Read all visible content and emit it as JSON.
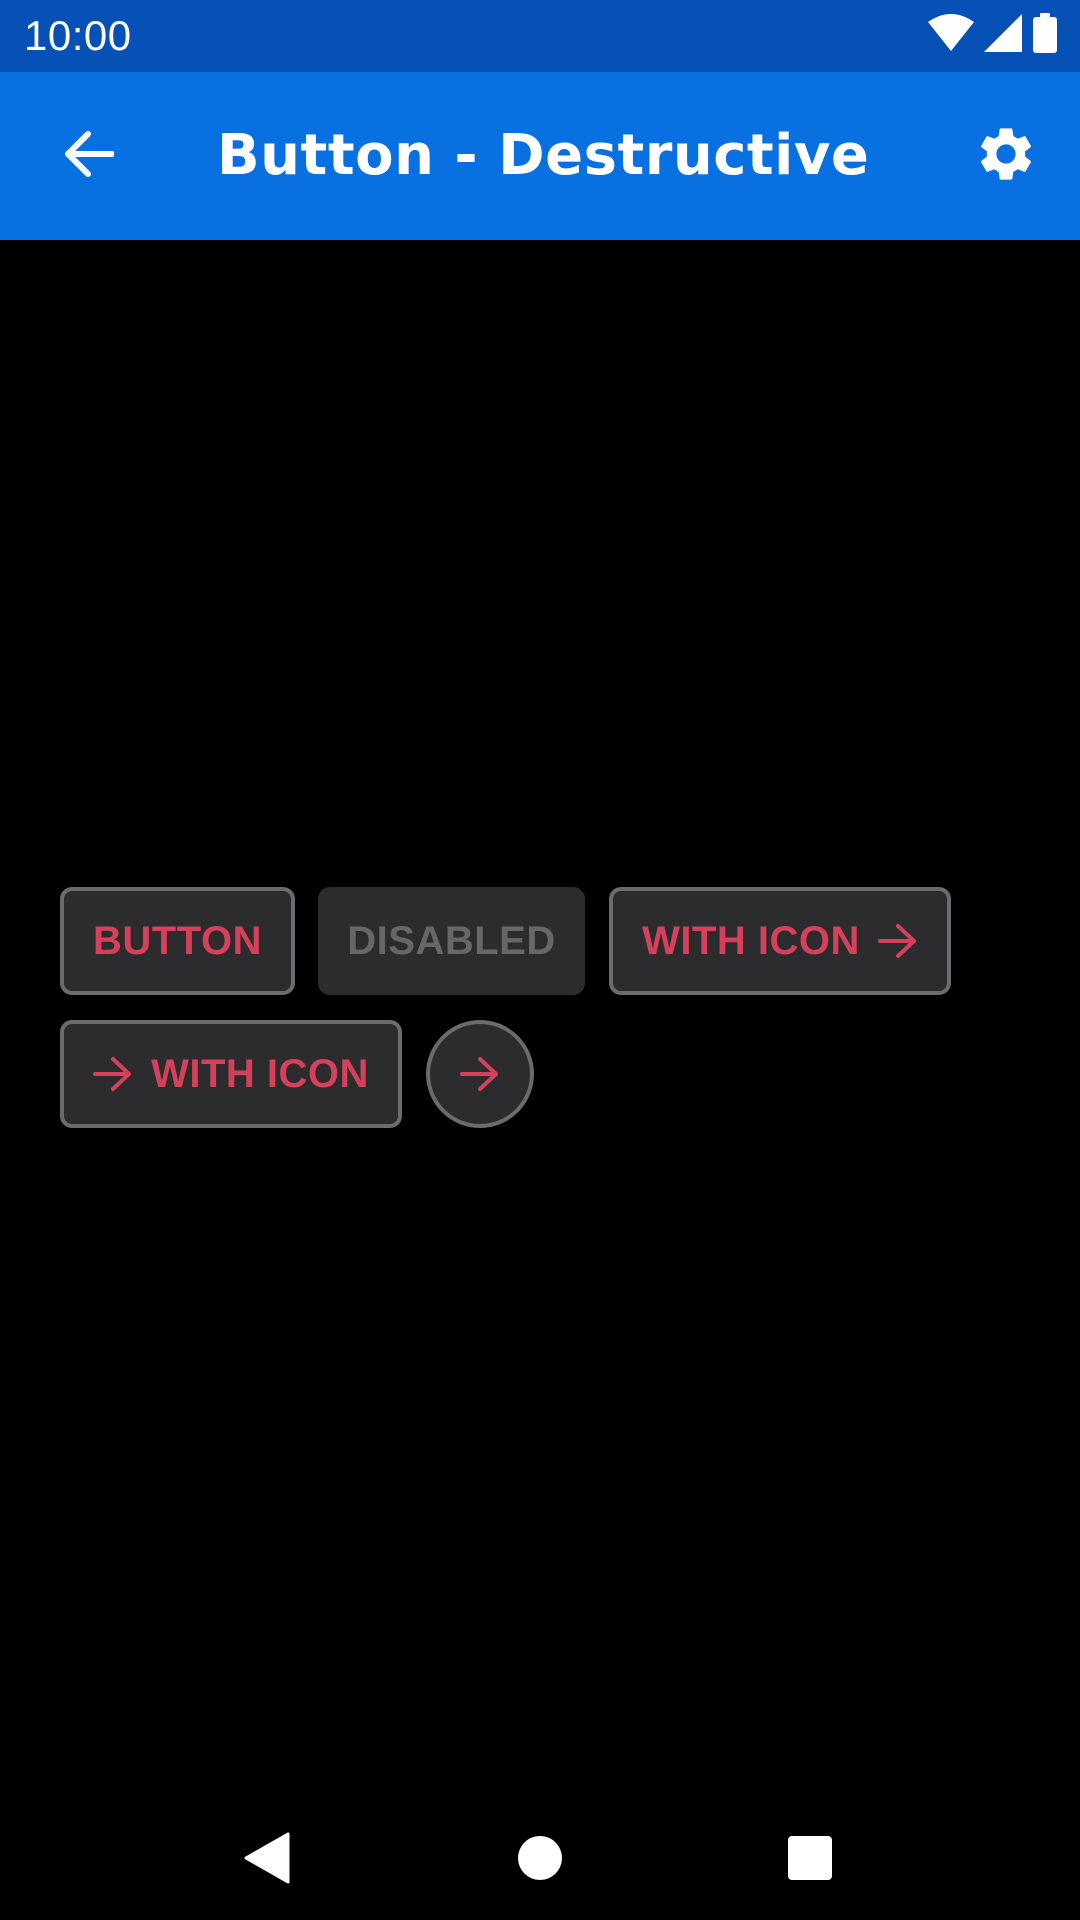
{
  "status_bar": {
    "time": "10:00",
    "icons": [
      "wifi-icon",
      "cellular-signal-icon",
      "battery-icon"
    ],
    "background": "#0650b6"
  },
  "app_bar": {
    "title": "Button - Destructive",
    "back_icon": "arrow-back-icon",
    "settings_icon": "gear-icon",
    "background": "#0870e0"
  },
  "buttons": {
    "button_label": "BUTTON",
    "disabled_label": "DISABLED",
    "with_icon_trailing_label": "WITH ICON",
    "with_icon_leading_label": "WITH ICON",
    "icon": "arrow-forward-icon",
    "text_color": "#d6405a",
    "disabled_text_color": "#67676a",
    "fill": "#2c2c2e",
    "border": "#6b6b6d"
  },
  "nav_bar": {
    "icons": [
      "nav-back-icon",
      "nav-home-icon",
      "nav-recents-icon"
    ]
  }
}
